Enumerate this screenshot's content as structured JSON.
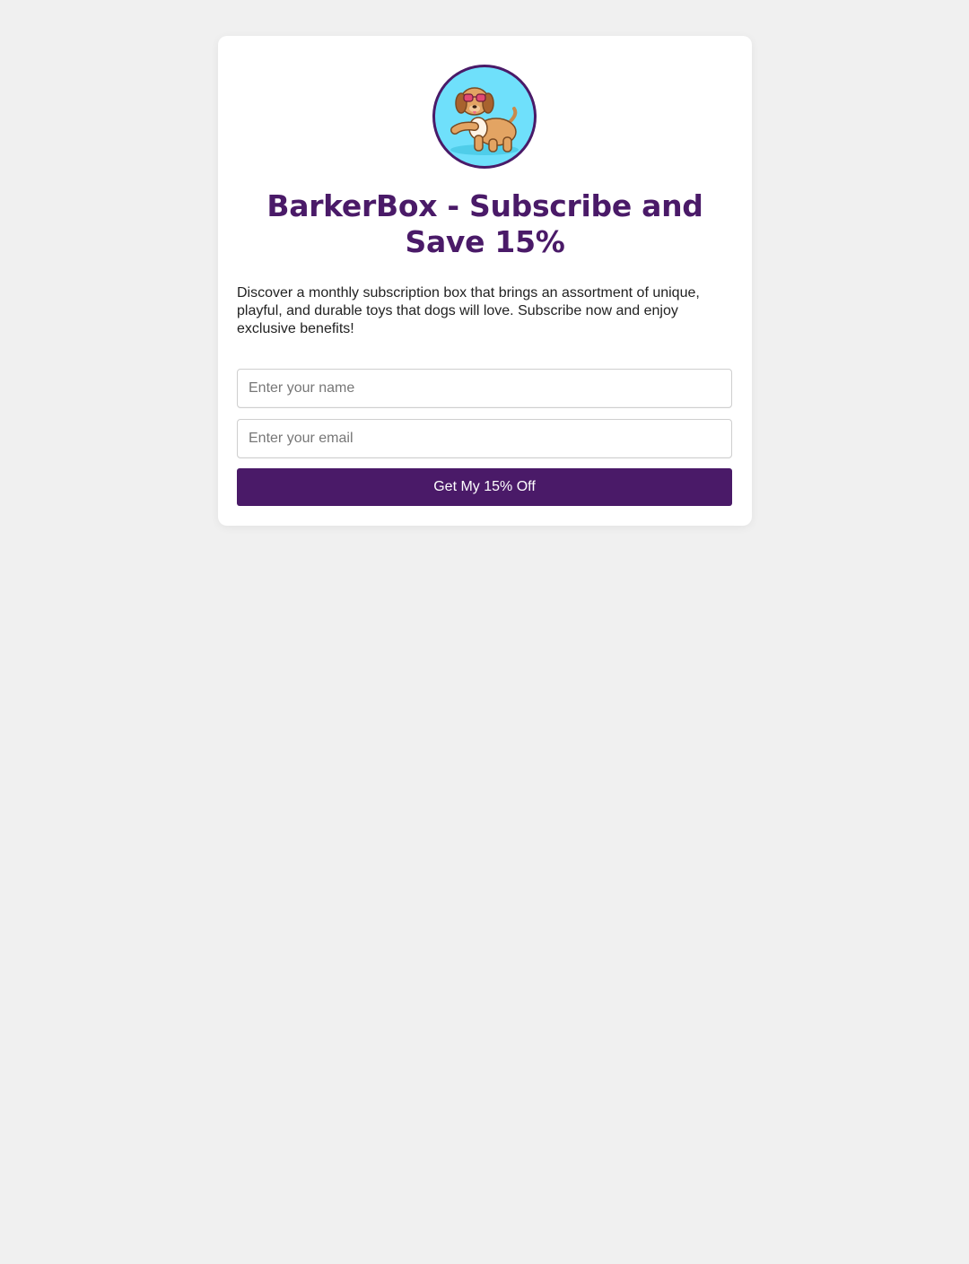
{
  "colors": {
    "page_background": "#f0f0f0",
    "card_background": "#ffffff",
    "brand_purple": "#4a1a68",
    "logo_background": "#6fe0fb"
  },
  "logo": {
    "icon": "dog-with-sunglasses-icon"
  },
  "header": {
    "title": "BarkerBox - Subscribe and Save 15%"
  },
  "main": {
    "description": "Discover a monthly subscription box that brings an assortment of unique, playful, and durable toys that dogs will love. Subscribe now and enjoy exclusive benefits!"
  },
  "form": {
    "name_placeholder": "Enter your name",
    "name_value": "",
    "email_placeholder": "Enter your email",
    "email_value": "",
    "submit_label": "Get My 15% Off"
  }
}
